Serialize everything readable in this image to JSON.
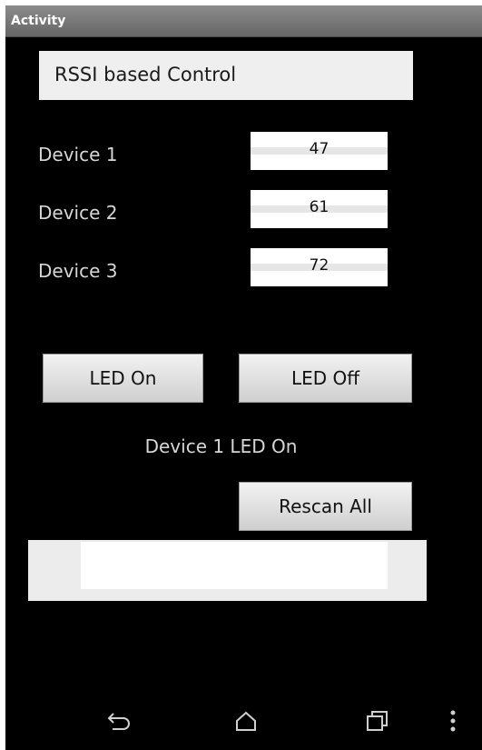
{
  "title_bar": {
    "title": "Activity"
  },
  "header": {
    "text": "RSSI based Control"
  },
  "devices": [
    {
      "label": "Device 1",
      "value": "47"
    },
    {
      "label": "Device 2",
      "value": "61"
    },
    {
      "label": "Device 3",
      "value": "72"
    }
  ],
  "buttons": {
    "led_on": "LED On",
    "led_off": "LED Off",
    "rescan": "Rescan All"
  },
  "status": {
    "text": "Device 1 LED On"
  },
  "text_field": {
    "value": ""
  },
  "nav": {
    "back_icon": "back-icon",
    "home_icon": "home-icon",
    "recents_icon": "recents-icon",
    "menu_icon": "overflow-menu-icon"
  },
  "colors": {
    "background": "#000000",
    "title_bar": "#7a7a7a",
    "label_text": "#d6d6d6",
    "button_face": "#e0e0e0"
  }
}
